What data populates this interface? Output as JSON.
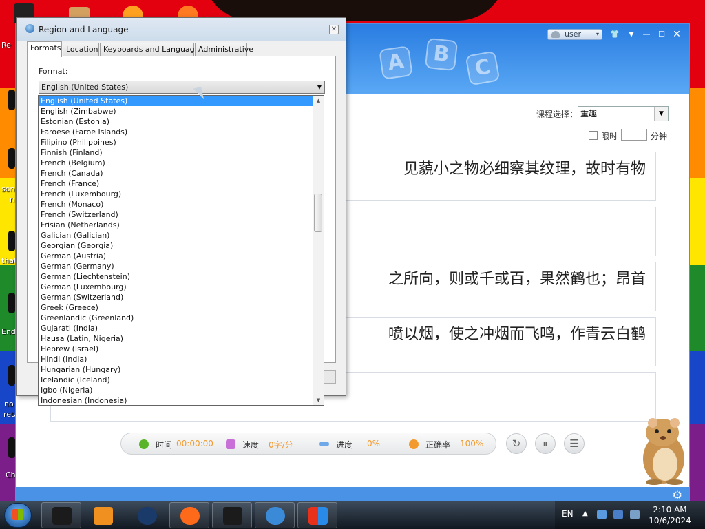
{
  "desktop": {
    "labels": [
      "Re",
      "son",
      "n",
      "that",
      "End",
      "no",
      "reta",
      "Ch"
    ]
  },
  "app": {
    "user": "user",
    "window_buttons": [
      "👕",
      "▾",
      "—",
      "☐",
      "✕"
    ],
    "header_letters": [
      "A",
      "B",
      "C"
    ],
    "course_label": "课程选择：",
    "course_value": "重趣",
    "limit_label": "限时",
    "minute_label": "分钟",
    "text_lines": [
      "见藐小之物必细察其纹理，故时有物",
      "",
      "之所向，则或千或百，果然鹤也；昂首",
      "喷以烟，使之冲烟而飞鸣，作青云白鹤",
      ""
    ],
    "stats": {
      "time_label": "时间",
      "time_value": "00:00:00",
      "speed_label": "速度",
      "speed_value": "0字/分",
      "progress_label": "进度",
      "progress_value": "0%",
      "accuracy_label": "正确率",
      "accuracy_value": "100%"
    },
    "controls": [
      "↻",
      "⏸",
      "☰"
    ],
    "settings_icon": "⚙"
  },
  "dialog": {
    "title": "Region and Language",
    "close": "✕",
    "tabs": [
      "Formats",
      "Location",
      "Keyboards and Languages",
      "Administrative"
    ],
    "format_label": "Format:",
    "format_value": "English (United States)",
    "options": [
      "English (United States)",
      "English (Zimbabwe)",
      "Estonian (Estonia)",
      "Faroese (Faroe Islands)",
      "Filipino (Philippines)",
      "Finnish (Finland)",
      "French (Belgium)",
      "French (Canada)",
      "French (France)",
      "French (Luxembourg)",
      "French (Monaco)",
      "French (Switzerland)",
      "Frisian (Netherlands)",
      "Galician (Galician)",
      "Georgian (Georgia)",
      "German (Austria)",
      "German (Germany)",
      "German (Liechtenstein)",
      "German (Luxembourg)",
      "German (Switzerland)",
      "Greek (Greece)",
      "Greenlandic (Greenland)",
      "Gujarati (India)",
      "Hausa (Latin, Nigeria)",
      "Hebrew (Israel)",
      "Hindi (India)",
      "Hungarian (Hungary)",
      "Icelandic (Iceland)",
      "Igbo (Nigeria)",
      "Indonesian (Indonesia)"
    ],
    "selected_index": 0
  },
  "taskbar": {
    "language": "EN",
    "time": "2:10 AM",
    "date": "10/6/2024",
    "tray_up": "▲"
  }
}
